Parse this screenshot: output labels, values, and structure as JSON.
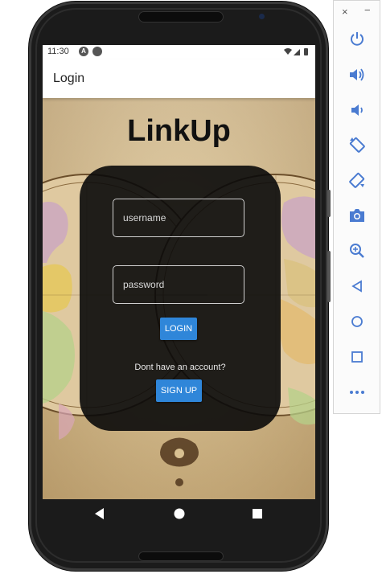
{
  "status_bar": {
    "time": "11:30",
    "badge_a": "A"
  },
  "app_bar": {
    "title": "Login"
  },
  "main": {
    "app_name": "LinkUp",
    "username": {
      "value": "",
      "placeholder": "username"
    },
    "password": {
      "value": "",
      "placeholder": "password"
    },
    "login_label": "LOGIN",
    "no_account_text": "Dont have an account?",
    "signup_label": "SIGN UP"
  },
  "nav": {
    "back_icon": "back-triangle-icon",
    "home_icon": "home-circle-icon",
    "recents_icon": "recents-square-icon"
  },
  "emulator_panel": {
    "close_label": "×",
    "minimize_label": "−",
    "buttons": [
      "power-icon",
      "volume-up-icon",
      "volume-down-icon",
      "rotate-left-icon",
      "rotate-right-icon",
      "camera-icon",
      "zoom-icon",
      "back-icon",
      "home-icon",
      "overview-icon",
      "more-icon"
    ]
  },
  "colors": {
    "accent": "#2f86d9",
    "card": "#0a0a0a",
    "emulator_icon": "#4a7bd1"
  }
}
